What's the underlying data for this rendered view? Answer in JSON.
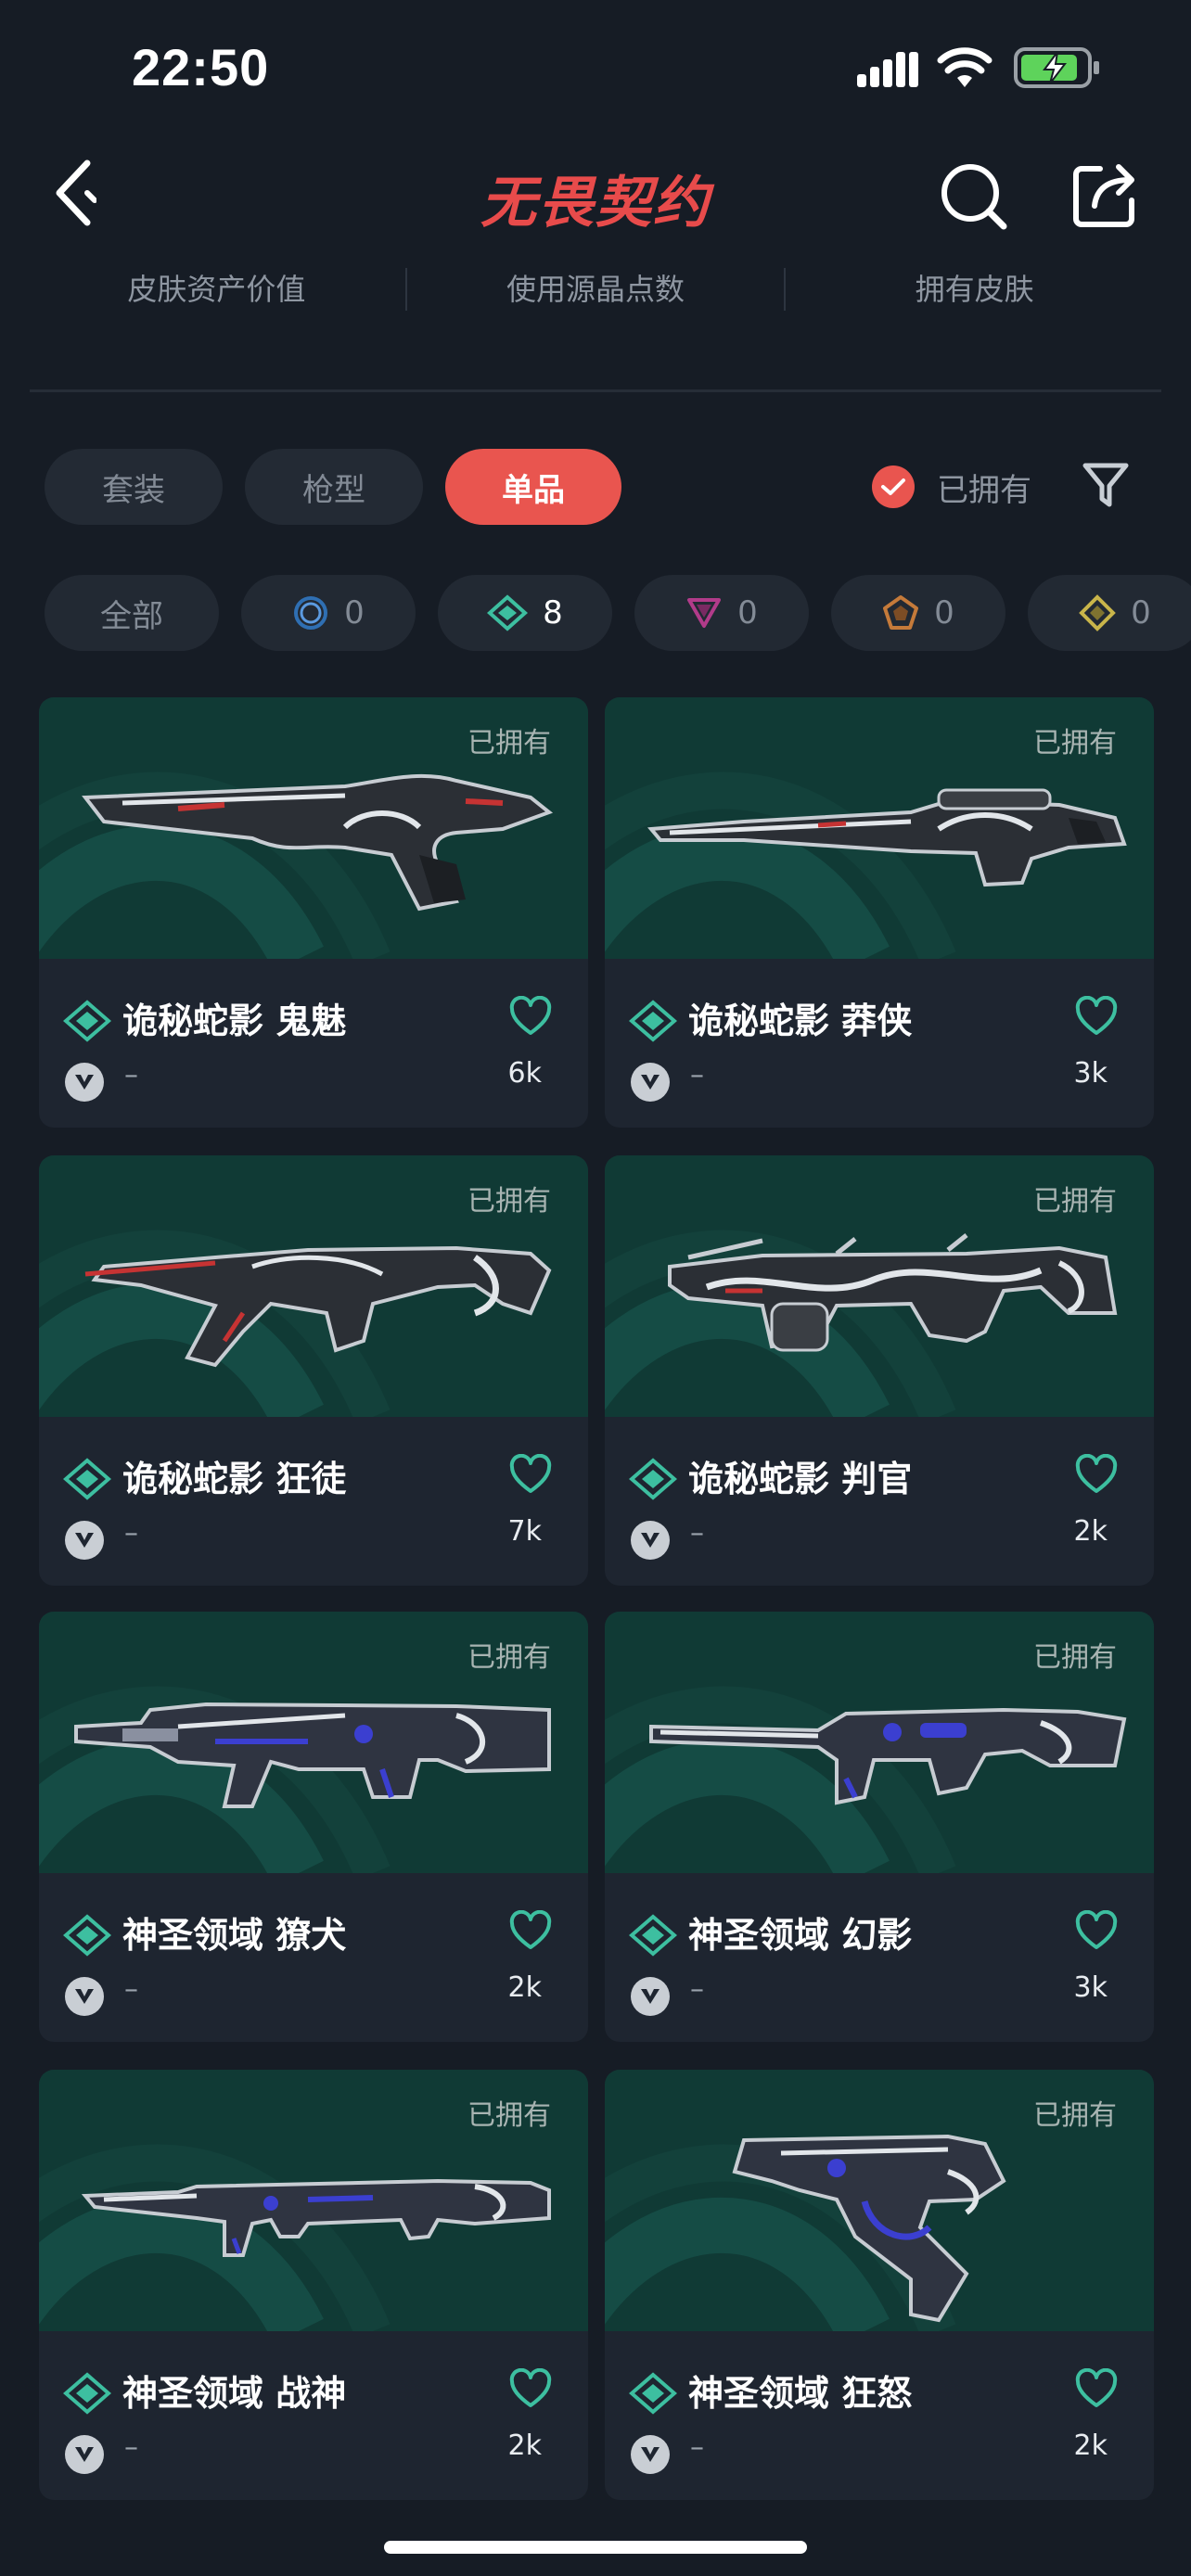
{
  "status_bar": {
    "time": "22:50"
  },
  "header": {
    "title": "无畏契约"
  },
  "stats": [
    "皮肤资产价值",
    "使用源晶点数",
    "拥有皮肤"
  ],
  "categories": [
    {
      "label": "套装",
      "active": false
    },
    {
      "label": "枪型",
      "active": false
    },
    {
      "label": "单品",
      "active": true
    }
  ],
  "owned_filter": {
    "label": "已拥有",
    "checked": true
  },
  "tiers": [
    {
      "label": "全部",
      "icon": "all"
    },
    {
      "label": "0",
      "icon": "select-tier-icon",
      "color": "#2f6fb3"
    },
    {
      "label": "8",
      "icon": "deluxe-tier-icon",
      "color": "#3dbfa0"
    },
    {
      "label": "0",
      "icon": "premium-tier-icon",
      "color": "#b23b8a"
    },
    {
      "label": "0",
      "icon": "exclusive-tier-icon",
      "color": "#c57a3a"
    },
    {
      "label": "0",
      "icon": "ultra-tier-icon",
      "color": "#c9b54a"
    }
  ],
  "cards": [
    {
      "owned_tag": "已拥有",
      "name": "诡秘蛇影 鬼魅",
      "value": "–",
      "likes": "6k",
      "weapon": "pistol",
      "accent": "#c63333"
    },
    {
      "owned_tag": "已拥有",
      "name": "诡秘蛇影 莽侠",
      "value": "–",
      "likes": "3k",
      "weapon": "sniper",
      "accent": "#c63333"
    },
    {
      "owned_tag": "已拥有",
      "name": "诡秘蛇影 狂徒",
      "value": "–",
      "likes": "7k",
      "weapon": "rifle",
      "accent": "#c63333"
    },
    {
      "owned_tag": "已拥有",
      "name": "诡秘蛇影 判官",
      "value": "–",
      "likes": "2k",
      "weapon": "shotgun",
      "accent": "#c63333"
    },
    {
      "owned_tag": "已拥有",
      "name": "神圣领域 獠犬",
      "value": "–",
      "likes": "2k",
      "weapon": "bulldog",
      "accent": "#3b3fd0"
    },
    {
      "owned_tag": "已拥有",
      "name": "神圣领域 幻影",
      "value": "–",
      "likes": "3k",
      "weapon": "phantom",
      "accent": "#3b3fd0"
    },
    {
      "owned_tag": "已拥有",
      "name": "神圣领域 战神",
      "value": "–",
      "likes": "2k",
      "weapon": "lmg",
      "accent": "#3b3fd0"
    },
    {
      "owned_tag": "已拥有",
      "name": "神圣领域 狂怒",
      "value": "–",
      "likes": "2k",
      "weapon": "frenzy",
      "accent": "#3b3fd0"
    }
  ]
}
